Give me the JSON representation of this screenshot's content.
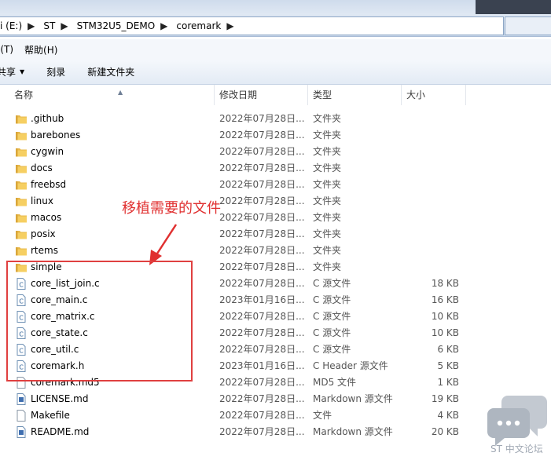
{
  "address": {
    "crumbs": [
      "i (E:)",
      "ST",
      "STM32U5_DEMO",
      "coremark"
    ]
  },
  "menu": [
    "l(T)",
    "帮助(H)"
  ],
  "toolbar": {
    "share": "共享",
    "burn": "刻录",
    "new_folder": "新建文件夹"
  },
  "columns": {
    "name": "名称",
    "date": "修改日期",
    "type": "类型",
    "size": "大小"
  },
  "files": [
    {
      "name": ".github",
      "date": "2022年07月28日...",
      "type": "文件夹",
      "size": "",
      "icon": "folder"
    },
    {
      "name": "barebones",
      "date": "2022年07月28日...",
      "type": "文件夹",
      "size": "",
      "icon": "folder"
    },
    {
      "name": "cygwin",
      "date": "2022年07月28日...",
      "type": "文件夹",
      "size": "",
      "icon": "folder"
    },
    {
      "name": "docs",
      "date": "2022年07月28日...",
      "type": "文件夹",
      "size": "",
      "icon": "folder"
    },
    {
      "name": "freebsd",
      "date": "2022年07月28日...",
      "type": "文件夹",
      "size": "",
      "icon": "folder"
    },
    {
      "name": "linux",
      "date": "2022年07月28日...",
      "type": "文件夹",
      "size": "",
      "icon": "folder"
    },
    {
      "name": "macos",
      "date": "2022年07月28日...",
      "type": "文件夹",
      "size": "",
      "icon": "folder"
    },
    {
      "name": "posix",
      "date": "2022年07月28日...",
      "type": "文件夹",
      "size": "",
      "icon": "folder"
    },
    {
      "name": "rtems",
      "date": "2022年07月28日...",
      "type": "文件夹",
      "size": "",
      "icon": "folder"
    },
    {
      "name": "simple",
      "date": "2022年07月28日...",
      "type": "文件夹",
      "size": "",
      "icon": "folder"
    },
    {
      "name": "core_list_join.c",
      "date": "2022年07月28日...",
      "type": "C 源文件",
      "size": "18 KB",
      "icon": "c-file"
    },
    {
      "name": "core_main.c",
      "date": "2023年01月16日...",
      "type": "C 源文件",
      "size": "16 KB",
      "icon": "c-file"
    },
    {
      "name": "core_matrix.c",
      "date": "2022年07月28日...",
      "type": "C 源文件",
      "size": "10 KB",
      "icon": "c-file"
    },
    {
      "name": "core_state.c",
      "date": "2022年07月28日...",
      "type": "C 源文件",
      "size": "10 KB",
      "icon": "c-file"
    },
    {
      "name": "core_util.c",
      "date": "2022年07月28日...",
      "type": "C 源文件",
      "size": "6 KB",
      "icon": "c-file"
    },
    {
      "name": "coremark.h",
      "date": "2023年01月16日...",
      "type": "C Header 源文件",
      "size": "5 KB",
      "icon": "h-file"
    },
    {
      "name": "coremark.md5",
      "date": "2022年07月28日...",
      "type": "MD5 文件",
      "size": "1 KB",
      "icon": "file"
    },
    {
      "name": "LICENSE.md",
      "date": "2022年07月28日...",
      "type": "Markdown 源文件",
      "size": "19 KB",
      "icon": "md-file"
    },
    {
      "name": "Makefile",
      "date": "2022年07月28日...",
      "type": "文件",
      "size": "4 KB",
      "icon": "file"
    },
    {
      "name": "README.md",
      "date": "2022年07月28日...",
      "type": "Markdown 源文件",
      "size": "20 KB",
      "icon": "md-file"
    }
  ],
  "annotation": {
    "text": "移植需要的文件",
    "color": "#e03030"
  },
  "watermark": {
    "text": "ST 中文论坛"
  }
}
